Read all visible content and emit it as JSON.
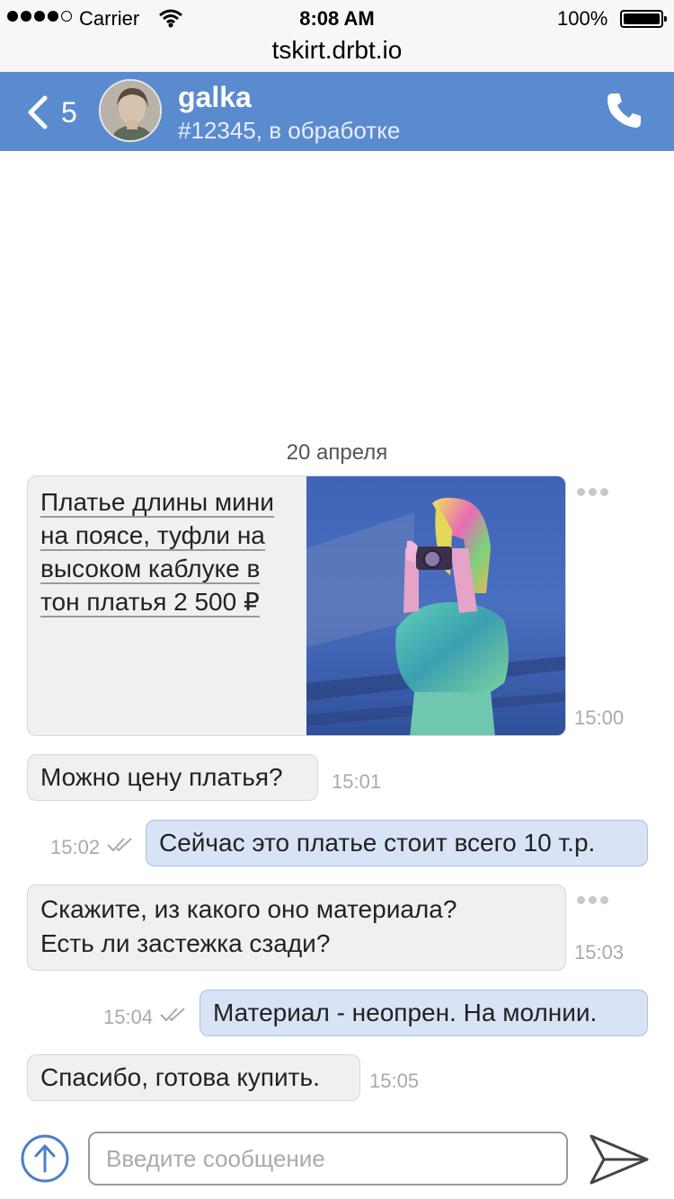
{
  "status_bar": {
    "carrier": "Carrier",
    "time": "8:08 AM",
    "battery": "100%"
  },
  "url": "tskirt.drbt.io",
  "header": {
    "back_count": "5",
    "name": "galka",
    "subtitle": "#12345, в обработке",
    "back_icon": "chevron-left-icon",
    "call_icon": "phone-icon",
    "color": "#5b8bcf"
  },
  "chat": {
    "date": "20 апреля",
    "product": {
      "lines": [
        "Платье длины мини",
        "на поясе, туфли на",
        "высоком каблуке в",
        "тон платья 2 500 ₽"
      ],
      "time": "15:00"
    },
    "messages": [
      {
        "text": "Можно цену платья?",
        "time": "15:01",
        "direction": "in"
      },
      {
        "text": "Сейчас это платье стоит всего 10 т.р.",
        "time": "15:02",
        "direction": "out"
      },
      {
        "text_line1": "Скажите, из какого оно материала?",
        "text_line2": "Есть ли застежка сзади?",
        "time": "15:03",
        "direction": "in"
      },
      {
        "text": "Материал - неопрен. На молнии.",
        "time": "15:04",
        "direction": "out"
      },
      {
        "text": "Спасибо, готова купить.",
        "time": "15:05",
        "direction": "in"
      }
    ],
    "incoming_color": "#f0f0f0",
    "outgoing_color": "#d8e3f5"
  },
  "composer": {
    "placeholder": "Введите сообщение",
    "value": "",
    "attach_icon": "upload-arrow-icon",
    "send_icon": "send-icon"
  }
}
